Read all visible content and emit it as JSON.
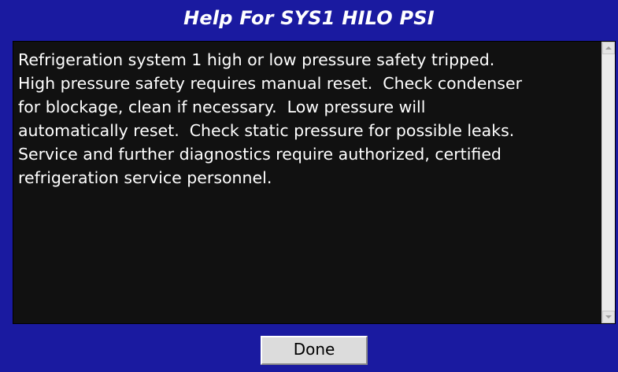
{
  "dialog": {
    "title": "Help For SYS1 HILO PSI",
    "help_text": "Refrigeration system 1 high or low pressure safety tripped.\nHigh pressure safety requires manual reset.  Check condenser\nfor blockage, clean if necessary.  Low pressure will\nautomatically reset.  Check static pressure for possible leaks.\nService and further diagnostics require authorized, certified\nrefrigeration service personnel.",
    "done_label": "Done"
  },
  "colors": {
    "background": "#1a1aa0",
    "text_panel": "#111111",
    "text": "#ffffff",
    "button": "#dcdcdc"
  },
  "icons": {
    "scroll_up": "chevron-up-icon",
    "scroll_down": "chevron-down-icon"
  }
}
